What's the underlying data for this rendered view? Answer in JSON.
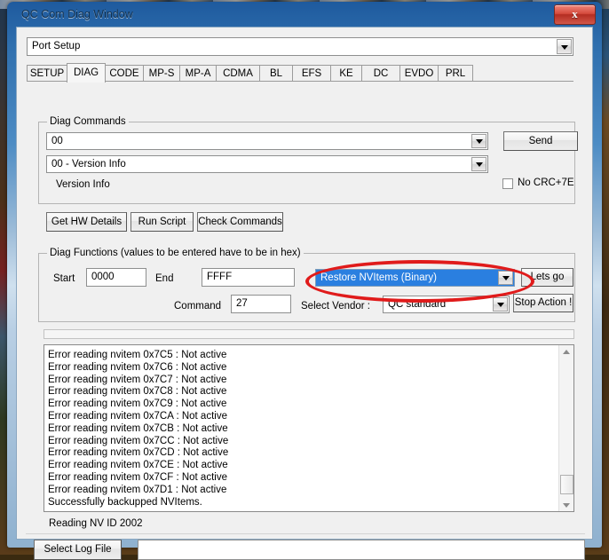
{
  "window": {
    "title": "QC Com Diag Window",
    "close_glyph": "x",
    "close_name": "close"
  },
  "port": {
    "value": "Port Setup"
  },
  "tabs": [
    {
      "label": "SETUP",
      "selected": false
    },
    {
      "label": "DIAG",
      "selected": true
    },
    {
      "label": "CODE",
      "selected": false
    },
    {
      "label": "MP-S",
      "selected": false
    },
    {
      "label": "MP-A",
      "selected": false
    },
    {
      "label": "CDMA",
      "selected": false
    },
    {
      "label": "BL",
      "selected": false
    },
    {
      "label": "EFS",
      "selected": false
    },
    {
      "label": "KE",
      "selected": false
    },
    {
      "label": "DC",
      "selected": false
    },
    {
      "label": "EVDO",
      "selected": false
    },
    {
      "label": "PRL",
      "selected": false
    }
  ],
  "diag_commands": {
    "legend": "Diag Commands",
    "command_value": "00",
    "description_value": "00 - Version Info",
    "info_label": "Version Info",
    "send_label": "Send",
    "crc_label": "No CRC+7E",
    "crc_checked": false
  },
  "actions": {
    "get_hw_details": "Get HW Details",
    "run_script": "Run Script",
    "check_commands": "Check Commands"
  },
  "diag_functions": {
    "legend": "Diag Functions (values to be entered have to be in hex)",
    "start_label": "Start",
    "start_value": "0000",
    "end_label": "End",
    "end_value": "FFFF",
    "action_value": "Restore NVItems (Binary)",
    "lets_go_label": "Lets go",
    "command_label": "Command",
    "command_value": "27",
    "vendor_label": "Select Vendor :",
    "vendor_value": "QC standard",
    "stop_action_label": "Stop Action !"
  },
  "log": {
    "lines": [
      "Error reading nvitem 0x7C5 : Not active",
      "Error reading nvitem 0x7C6 : Not active",
      "Error reading nvitem 0x7C7 : Not active",
      "Error reading nvitem 0x7C8 : Not active",
      "Error reading nvitem 0x7C9 : Not active",
      "Error reading nvitem 0x7CA : Not active",
      "Error reading nvitem 0x7CB : Not active",
      "Error reading nvitem 0x7CC : Not active",
      "Error reading nvitem 0x7CD : Not active",
      "Error reading nvitem 0x7CE : Not active",
      "Error reading nvitem 0x7CF : Not active",
      "Error reading nvitem 0x7D1 : Not active",
      "Successfully backupped NVItems."
    ],
    "text": ""
  },
  "status": {
    "text": "Reading NV ID 2002"
  },
  "footer": {
    "select_log_label": "Select Log File",
    "log_path_value": ""
  },
  "annotation": {
    "shape": "ellipse",
    "color": "#e01b1b"
  }
}
